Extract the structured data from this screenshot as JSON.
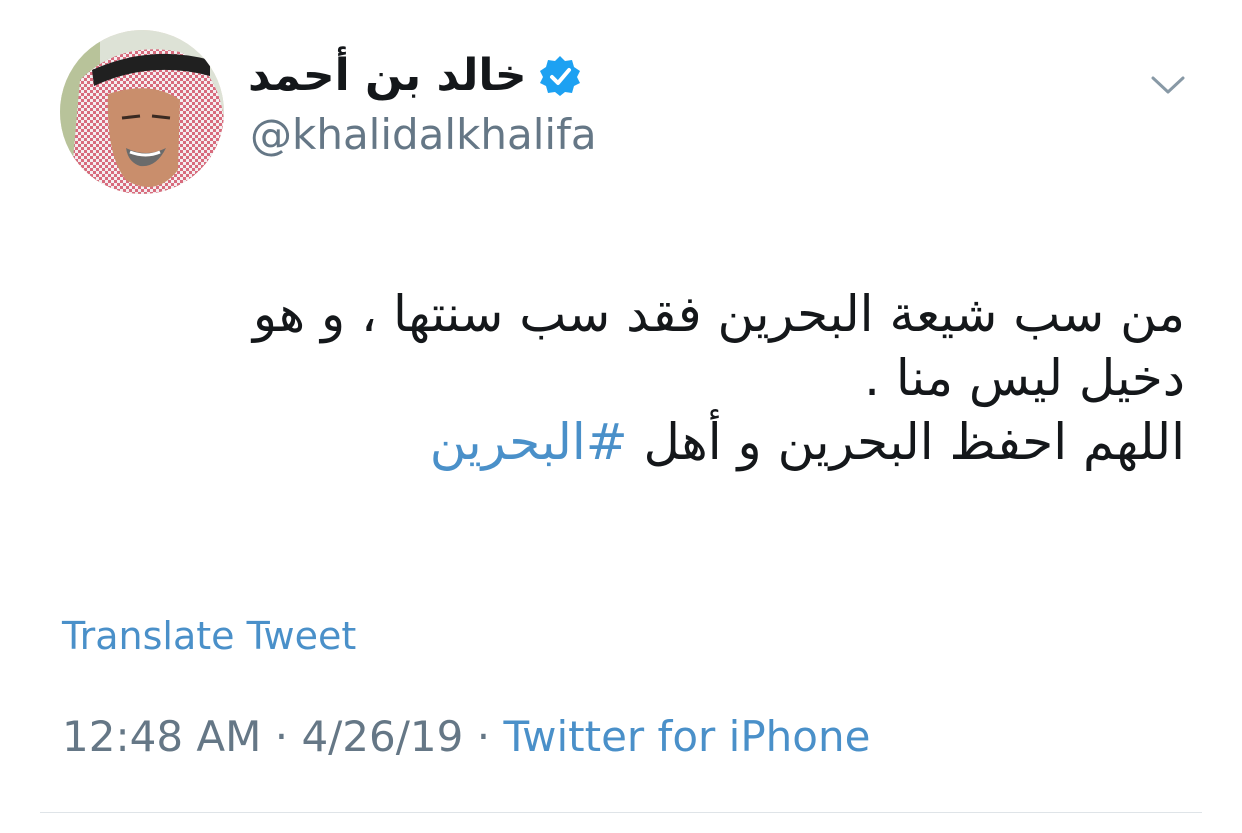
{
  "author": {
    "display_name": "خالد بن أحمد",
    "handle": "@khalidalkhalifa",
    "verified": true,
    "avatar_icon": "profile-photo"
  },
  "tweet": {
    "line1": "من سب شيعة البحرين فقد سب سنتها ، و هو",
    "line2": "دخيل ليس منا .",
    "line3_text": "اللهم احفظ البحرين و أهل ",
    "hashtag": "#البحرين"
  },
  "translate_label": "Translate Tweet",
  "meta": {
    "time": "12:48 AM",
    "separator": "·",
    "date": "4/26/19",
    "source": "Twitter for iPhone"
  },
  "colors": {
    "link": "#4a90c9",
    "secondary_text": "#657786",
    "primary_text": "#14171a",
    "verified_badge": "#1da1f2"
  },
  "icons": {
    "verified": "verified-badge-icon",
    "menu": "chevron-down-icon"
  }
}
